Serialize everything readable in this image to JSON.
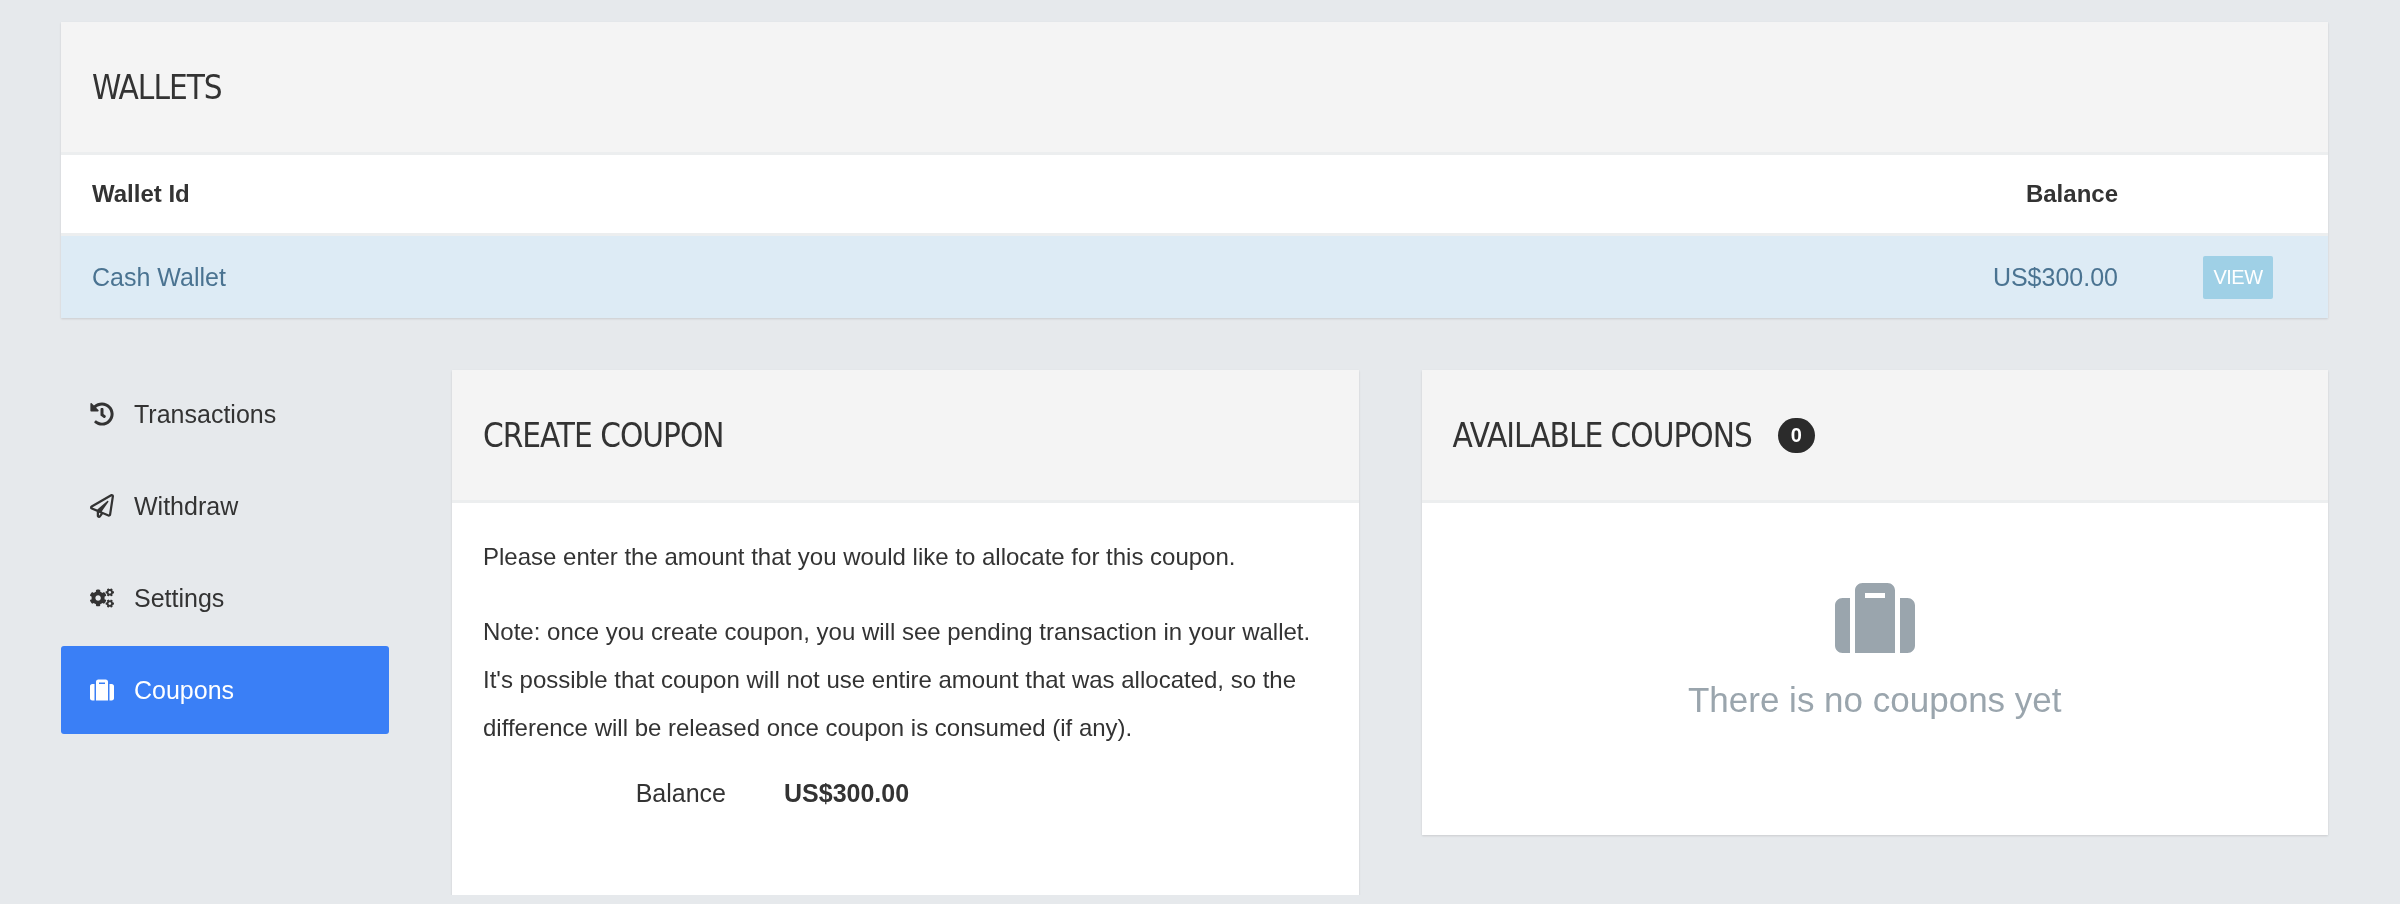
{
  "wallets": {
    "title": "WALLETS",
    "columns": [
      "Wallet Id",
      "Balance"
    ],
    "rows": [
      {
        "name": "Cash Wallet",
        "balance": "US$300.00",
        "action": "VIEW"
      }
    ]
  },
  "sidebar": {
    "items": [
      {
        "kind": "history",
        "label": "Transactions",
        "selected": false
      },
      {
        "kind": "send",
        "label": "Withdraw",
        "selected": false
      },
      {
        "kind": "settings",
        "label": "Settings",
        "selected": false
      },
      {
        "kind": "coupons",
        "label": "Coupons",
        "selected": true
      }
    ]
  },
  "create_coupon": {
    "title": "CREATE COUPON",
    "paragraphs": [
      "Please enter the amount that you would like to allocate for this coupon.",
      "Note: once you create coupon, you will see pending transaction in your wallet. It's possible that coupon will not use entire amount that was allocated, so the difference will be released once coupon is consumed (if any)."
    ],
    "balance_label": "Balance",
    "balance_value": "US$300.00"
  },
  "available_coupons": {
    "title": "AVAILABLE COUPONS",
    "count": "0",
    "empty_message": "There is no coupons yet"
  }
}
